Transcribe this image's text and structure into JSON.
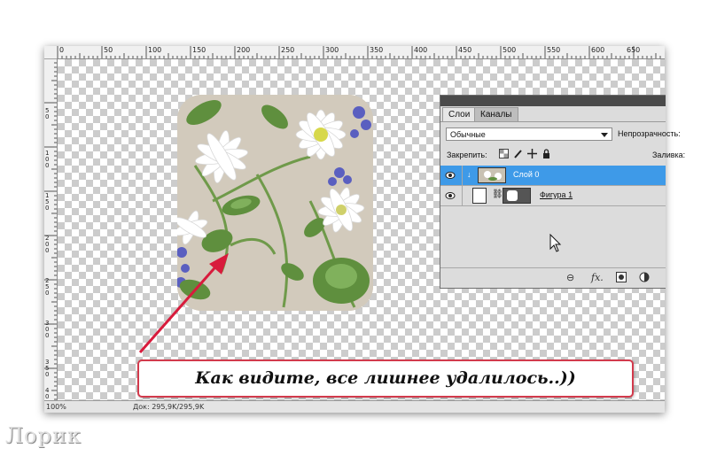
{
  "ruler": {
    "top_ticks": [
      "0",
      "50",
      "100",
      "150",
      "200",
      "250",
      "300",
      "350",
      "400",
      "450",
      "500",
      "550",
      "600",
      "650"
    ],
    "left_ticks": [
      "50",
      "100",
      "150",
      "200",
      "250",
      "300",
      "350",
      "400"
    ]
  },
  "status_bar": {
    "zoom": "100%",
    "doc_size": "Док: 295,9K/295,9K"
  },
  "layers_panel": {
    "tabs": [
      "Слои",
      "Каналы"
    ],
    "blend_mode": "Обычные",
    "opacity_label": "Непрозрачность:",
    "lock_label": "Закрепить:",
    "lock_icons": [
      "lock-transparent-icon",
      "brush-lock-icon",
      "move-lock-icon",
      "padlock-icon"
    ],
    "fill_label": "Заливка:",
    "layers": [
      {
        "name": "Слой 0",
        "visible": true,
        "selected": true
      },
      {
        "name": "Фигура 1",
        "visible": true,
        "selected": false
      }
    ],
    "footer_icons": [
      "link-icon",
      "fx-icon",
      "mask-icon",
      "adjustment-icon"
    ],
    "footer_fx": "fx."
  },
  "callout": {
    "text": "Как видите, все лишнее удалилось..))"
  },
  "watermark": "Лорик",
  "colors": {
    "selection": "#3e9ae8",
    "callout_border": "#d23a4c",
    "arrow": "#d81b3c"
  }
}
